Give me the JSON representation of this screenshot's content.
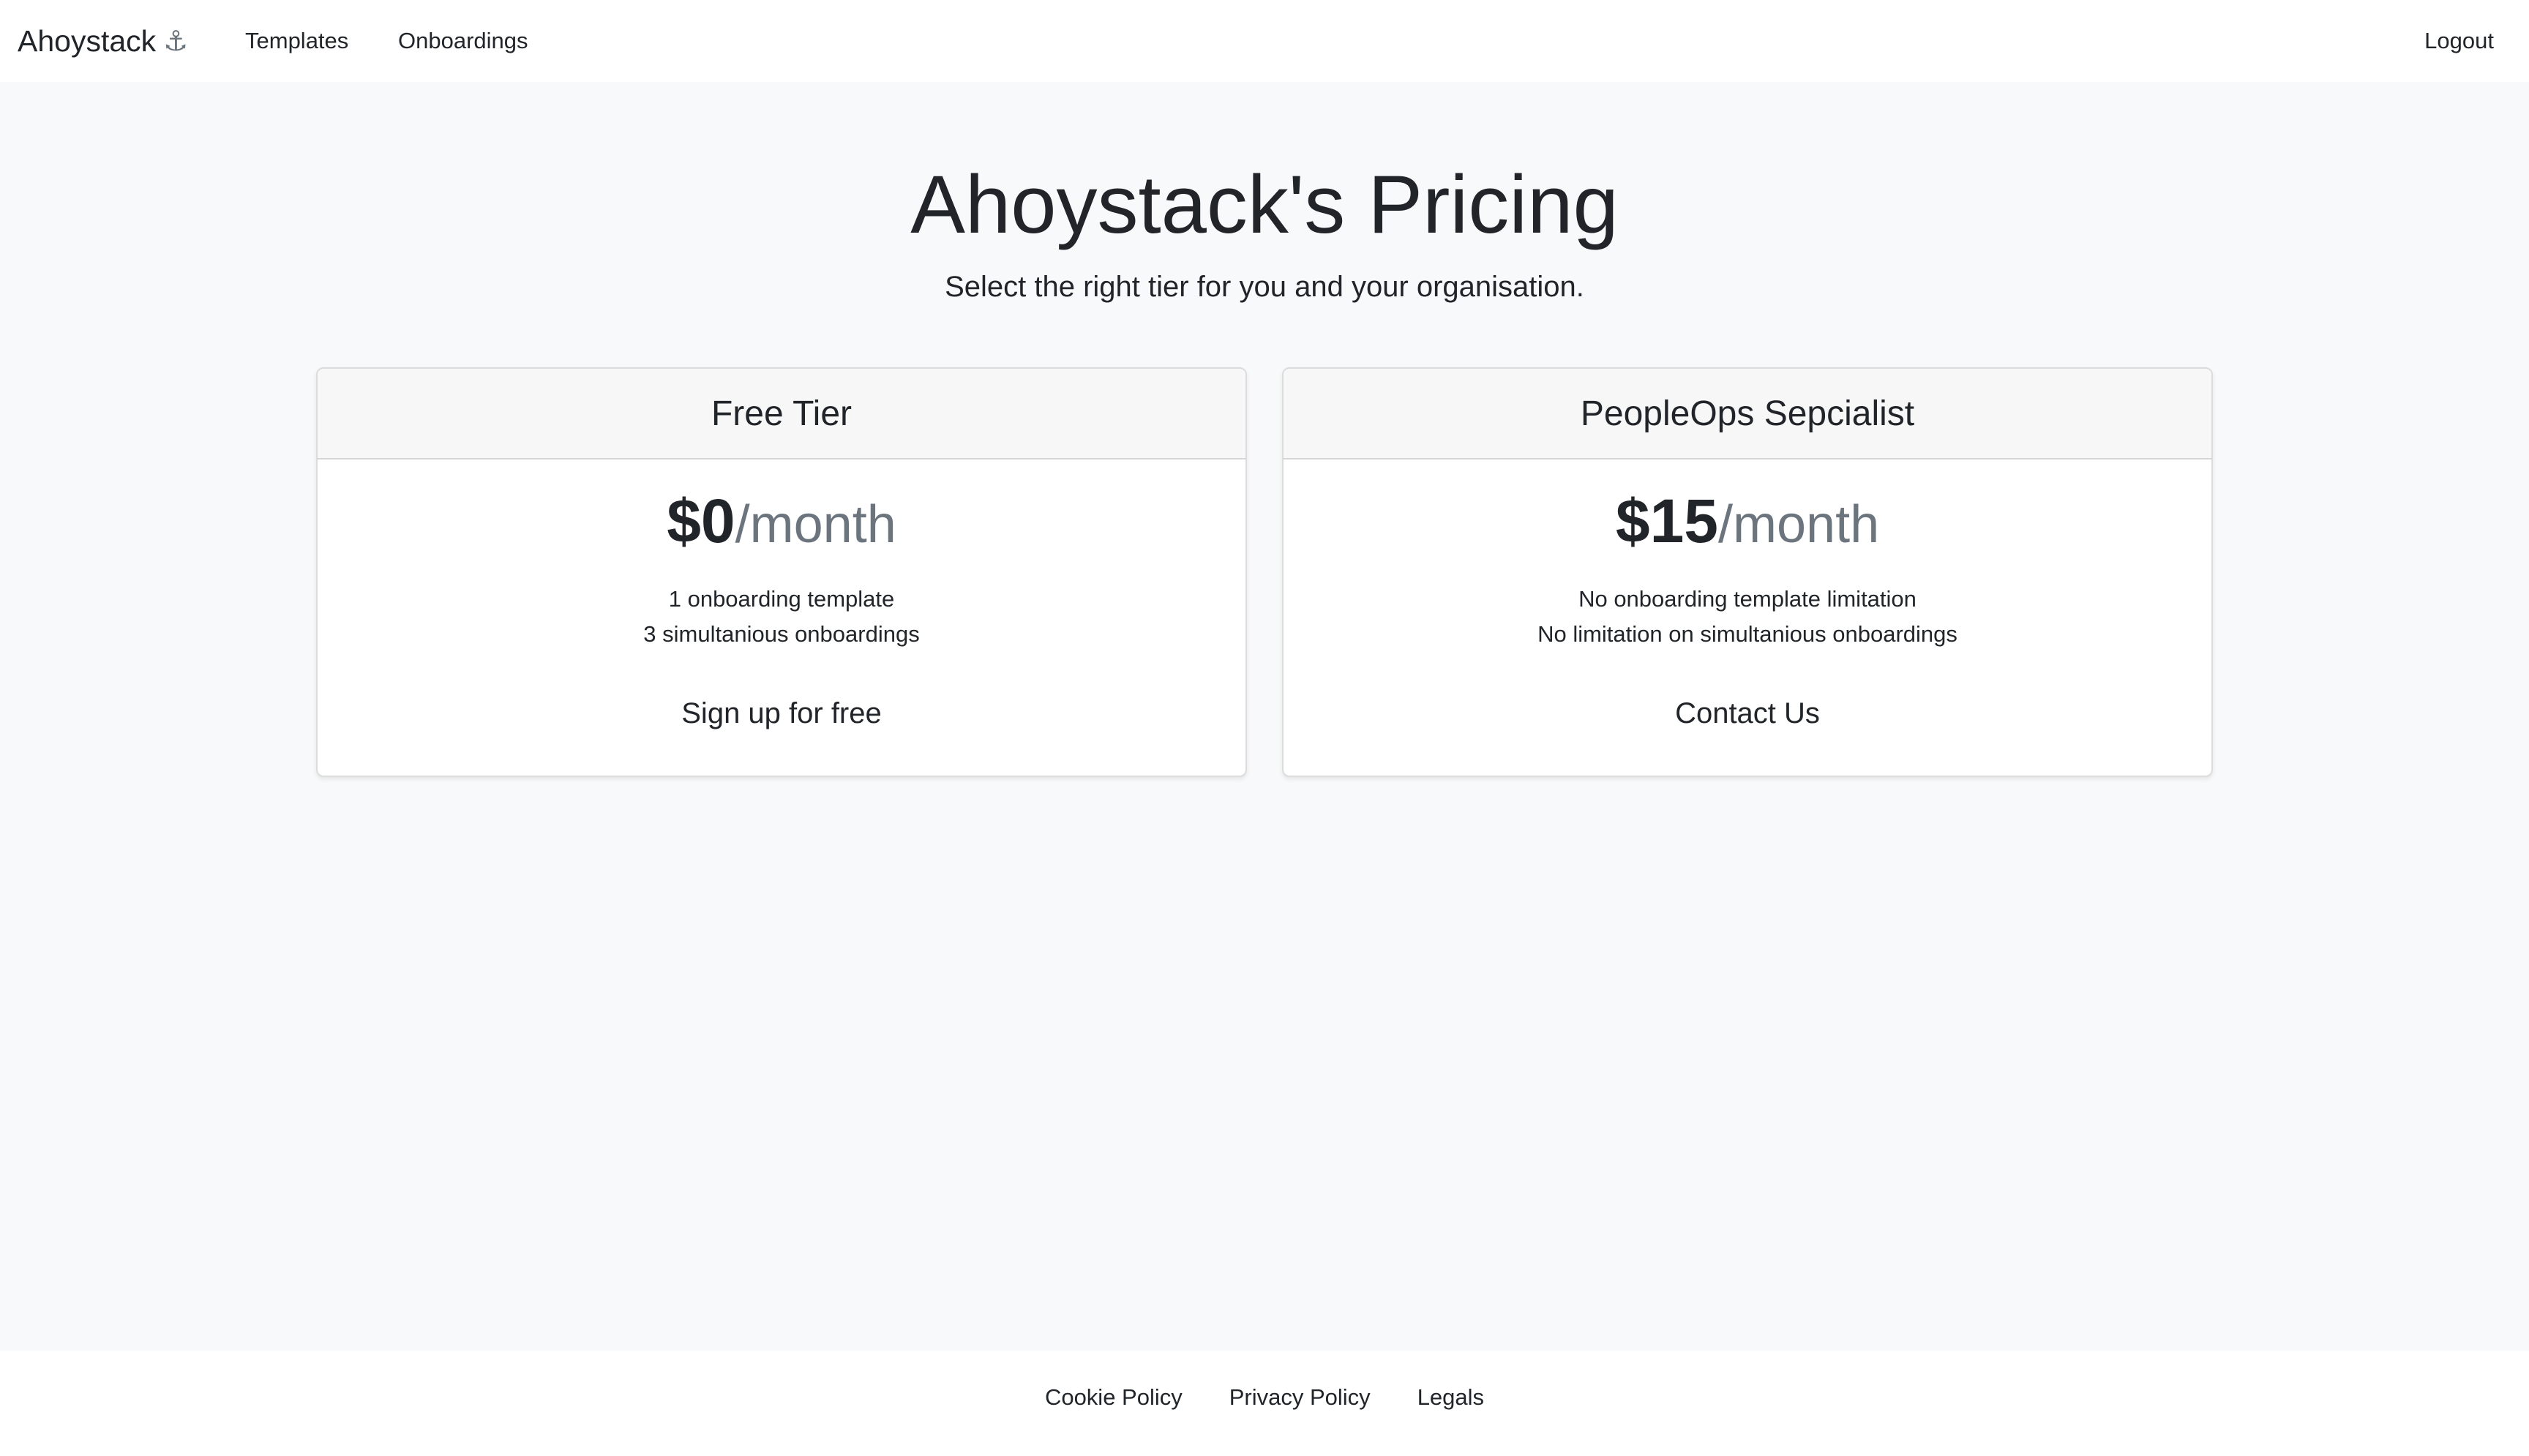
{
  "navbar": {
    "brand": "Ahoystack",
    "brand_icon": "⚓",
    "links": [
      {
        "label": "Templates"
      },
      {
        "label": "Onboardings"
      }
    ],
    "logout_label": "Logout"
  },
  "hero": {
    "title": "Ahoystack's Pricing",
    "subtitle": "Select the right tier for you and your organisation."
  },
  "tiers": [
    {
      "name": "Free Tier",
      "price": "$0",
      "period": "/month",
      "features": [
        "1 onboarding template",
        "3 simultanious onboardings"
      ],
      "cta": "Sign up for free"
    },
    {
      "name": "PeopleOps Sepcialist",
      "price": "$15",
      "period": "/month",
      "features": [
        "No onboarding template limitation",
        "No limitation on simultanious onboardings"
      ],
      "cta": "Contact Us"
    }
  ],
  "footer": {
    "links": [
      {
        "label": "Cookie Policy"
      },
      {
        "label": "Privacy Policy"
      },
      {
        "label": "Legals"
      }
    ]
  },
  "colors": {
    "page_background": "#f8f9fa",
    "surface": "#ffffff",
    "card_header": "#f7f7f7",
    "text": "#212529",
    "muted": "#6c757d"
  }
}
